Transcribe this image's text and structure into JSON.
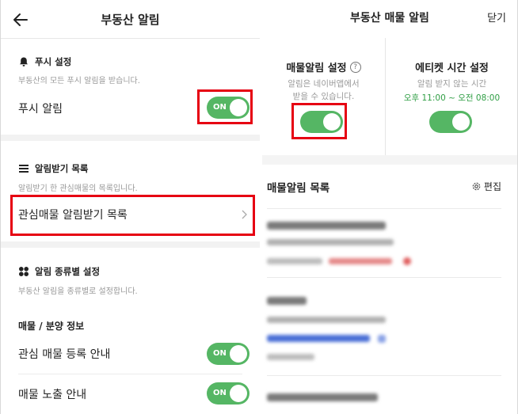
{
  "left": {
    "title": "부동산 알림",
    "push": {
      "section_title": "푸시 설정",
      "description": "부동산의 모든 푸시 알림을 받습니다.",
      "row_label": "푸시 알림",
      "toggle_text": "ON",
      "toggle_value": true
    },
    "subscribe": {
      "section_title": "알림받기 목록",
      "description": "알림받기 한 관심매물의 목록입니다.",
      "row_label": "관심매물 알림받기 목록"
    },
    "types": {
      "section_title": "알림 종류별 설정",
      "description": "부동산 알림을 종류별로 설정합니다.",
      "group_label": "매물 / 분양 정보",
      "items": [
        {
          "label": "관심 매물 등록 안내",
          "toggle_text": "ON",
          "value": true
        },
        {
          "label": "매물 노출 안내",
          "toggle_text": "ON",
          "value": true
        }
      ]
    },
    "icons": {
      "back": "back-arrow-icon",
      "bell": "bell-icon",
      "list": "list-icon",
      "grid": "grid-icon",
      "chevron": "chevron-right-icon"
    }
  },
  "right": {
    "title": "부동산 매물 알림",
    "close_label": "닫기",
    "alert_setting": {
      "title": "매물알림 설정",
      "help": "?",
      "description_line1": "알림은 네이버앱에서",
      "description_line2": "받을 수 있습니다.",
      "toggle_value": true
    },
    "etiquette": {
      "title": "에티켓 시간 설정",
      "description": "알림 받지 않는 시간",
      "time_range": "오후 11:00 ~ 오전 08:00",
      "toggle_value": true
    },
    "list_title": "매물알림 목록",
    "edit_label": "편집"
  },
  "colors": {
    "toggle_on": "#55b664",
    "highlight_box": "#e60012",
    "green_text": "#2f9e44",
    "blurred_link": "#4a6fd6"
  }
}
